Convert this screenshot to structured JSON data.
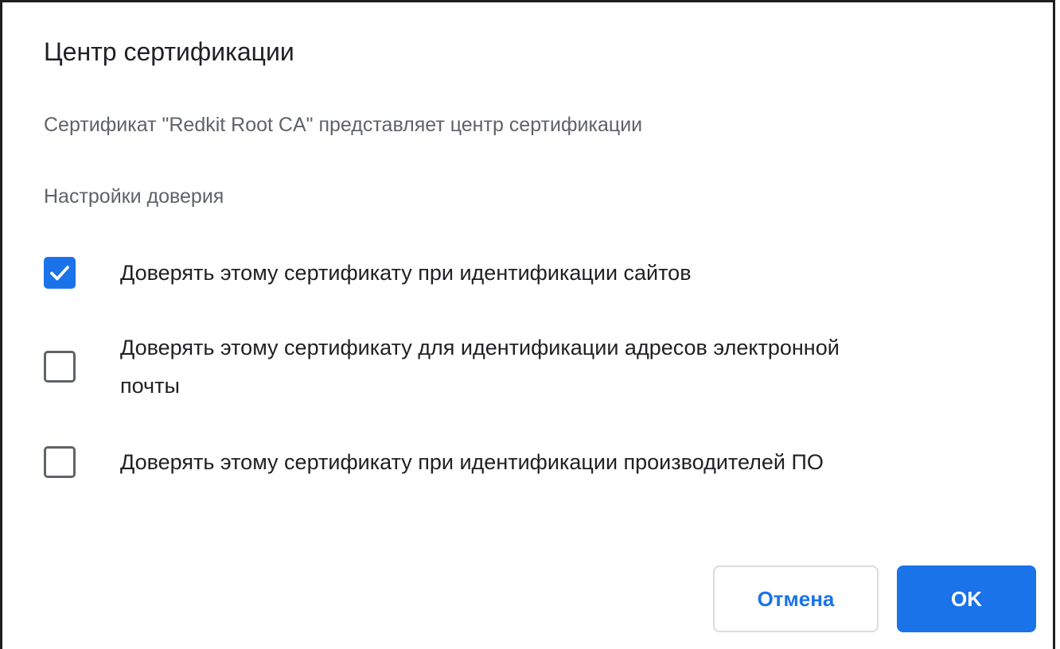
{
  "dialog": {
    "title": "Центр сертификации",
    "description": "Сертификат \"Redkit Root CA\" представляет центр сертификации",
    "section_heading": "Настройки доверия"
  },
  "options": [
    {
      "label": "Доверять этому сертификату при идентификации сайтов",
      "checked": true
    },
    {
      "label": "Доверять этому сертификату для идентификации адресов электронной почты",
      "checked": false
    },
    {
      "label": "Доверять этому сертификату при идентификации производителей ПО",
      "checked": false
    }
  ],
  "buttons": {
    "cancel_label": "Отмена",
    "ok_label": "OK"
  },
  "colors": {
    "accent": "#1a73e8",
    "text_primary": "#202124",
    "text_secondary": "#5f6368",
    "button_border": "#dadce0"
  },
  "icons": {
    "checked": "checkmark-icon"
  }
}
